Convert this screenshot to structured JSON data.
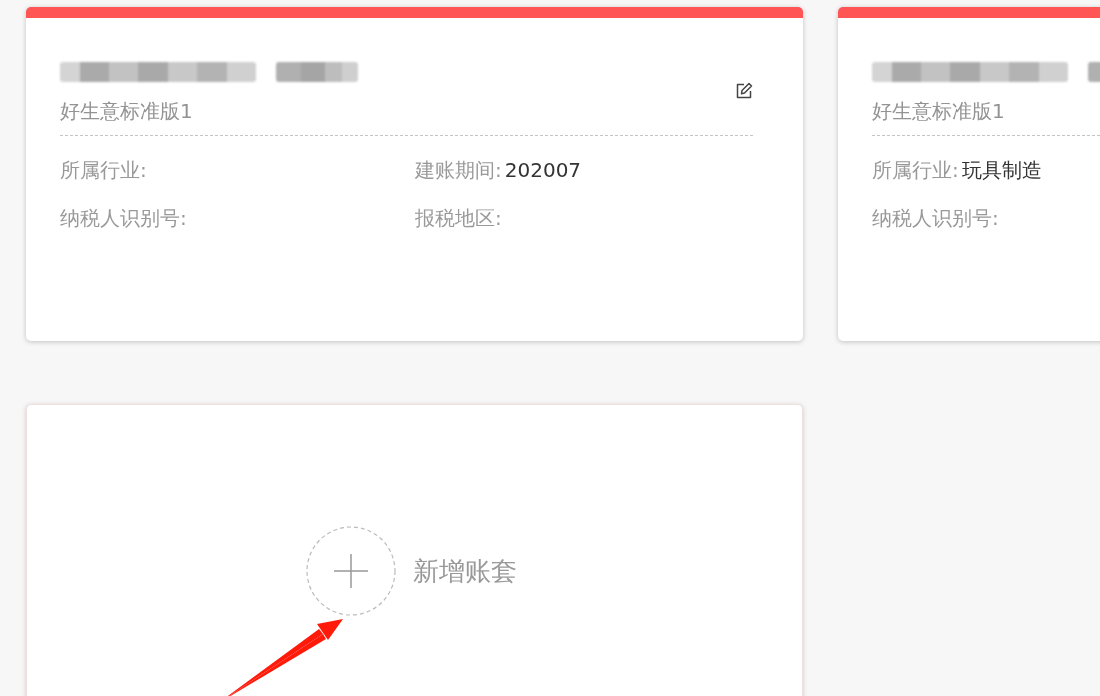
{
  "account_sets": [
    {
      "edition": "好生意标准版1",
      "rows": [
        [
          {
            "label": "所属行业:"
          },
          {
            "label": "建账期间:",
            "value": "202007"
          }
        ],
        [
          {
            "label": "纳税人识别号:"
          },
          {
            "label": "报税地区:"
          }
        ]
      ]
    },
    {
      "edition": "好生意标准版1",
      "rows": [
        [
          {
            "label": "所属行业:",
            "value": "玩具制造"
          }
        ],
        [
          {
            "label": "纳税人识别号:"
          }
        ]
      ]
    }
  ],
  "new_account_set": {
    "label": "新增账套"
  }
}
